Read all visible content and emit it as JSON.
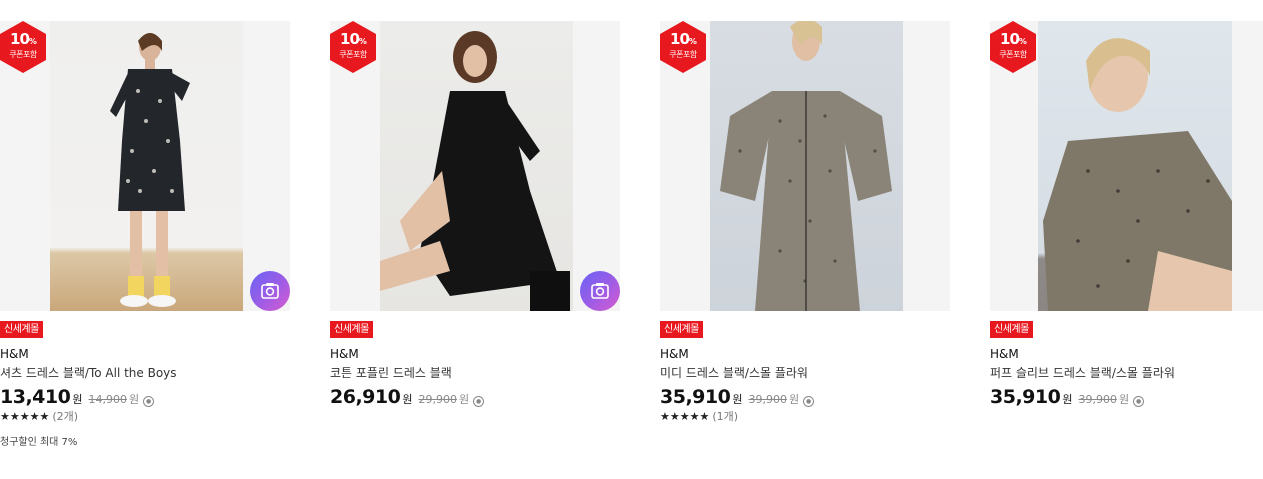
{
  "colors": {
    "accent": "#e8181f",
    "price": "#111111",
    "muted": "#888888"
  },
  "products": [
    {
      "badge": {
        "percent": "10",
        "percent_sign": "%",
        "label": "쿠폰포함"
      },
      "tag": "신세계몰",
      "brand": "H&M",
      "title": "셔츠 드레스 블랙/To All the Boys",
      "price": "13,410",
      "currency": "원",
      "original_price": "14,900",
      "original_currency": "원",
      "stars": "★★★★★",
      "review_count": "(2개)",
      "extra": "청구할인 최대 7%",
      "icon": "camera-icon"
    },
    {
      "badge": {
        "percent": "10",
        "percent_sign": "%",
        "label": "쿠폰포함"
      },
      "tag": "신세계몰",
      "brand": "H&M",
      "title": "코튼 포플린 드레스 블랙",
      "price": "26,910",
      "currency": "원",
      "original_price": "29,900",
      "original_currency": "원",
      "icon": "camera-icon"
    },
    {
      "badge": {
        "percent": "10",
        "percent_sign": "%",
        "label": "쿠폰포함"
      },
      "tag": "신세계몰",
      "brand": "H&M",
      "title": "미디 드레스 블랙/스몰 플라워",
      "price": "35,910",
      "currency": "원",
      "original_price": "39,900",
      "original_currency": "원",
      "stars": "★★★★★",
      "review_count": "(1개)"
    },
    {
      "badge": {
        "percent": "10",
        "percent_sign": "%",
        "label": "쿠폰포함"
      },
      "tag": "신세계몰",
      "brand": "H&M",
      "title": "퍼프 슬리브 드레스 블랙/스몰 플라워",
      "price": "35,910",
      "currency": "원",
      "original_price": "39,900",
      "original_currency": "원"
    }
  ]
}
